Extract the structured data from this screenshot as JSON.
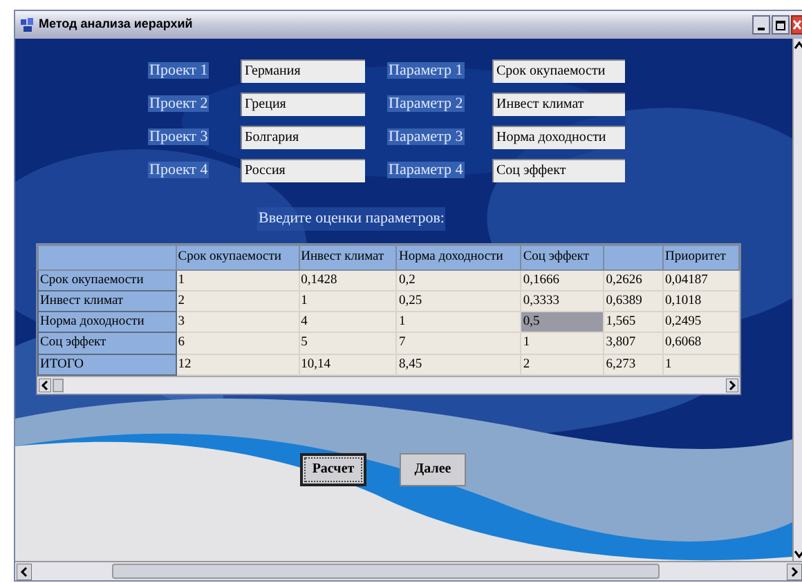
{
  "window": {
    "title": "Метод анализа иерархий"
  },
  "projects": [
    {
      "label": "Проект 1",
      "value": "Германия"
    },
    {
      "label": "Проект 2",
      "value": "Греция"
    },
    {
      "label": "Проект 3",
      "value": "Болгария"
    },
    {
      "label": "Проект 4",
      "value": "Россия"
    }
  ],
  "parameters": [
    {
      "label": "Параметр 1",
      "value": "Срок окупаемости"
    },
    {
      "label": "Параметр 2",
      "value": "Инвест климат"
    },
    {
      "label": "Параметр 3",
      "value": "Норма доходности"
    },
    {
      "label": "Параметр 4",
      "value": "Соц эффект"
    }
  ],
  "prompt": "Введите оценки параметров:",
  "table": {
    "columns": [
      "Срок окупаемости",
      "Инвест климат",
      "Норма доходности",
      "Соц эффект",
      null,
      "Приоритет"
    ],
    "rows": [
      {
        "header": "Срок окупаемости",
        "cells": [
          {
            "text": "1",
            "selected": false
          },
          {
            "text": "0,1428",
            "selected": false
          },
          {
            "text": "0,2",
            "selected": false
          },
          {
            "text": "0,1666",
            "selected": false
          },
          {
            "text": "0,2626",
            "selected": false
          },
          {
            "text": "0,04187",
            "selected": false
          }
        ]
      },
      {
        "header": "Инвест климат",
        "cells": [
          {
            "text": "2",
            "selected": false
          },
          {
            "text": "1",
            "selected": false
          },
          {
            "text": "0,25",
            "selected": false
          },
          {
            "text": "0,3333",
            "selected": false
          },
          {
            "text": "0,6389",
            "selected": false
          },
          {
            "text": "0,1018",
            "selected": false
          }
        ]
      },
      {
        "header": "Норма доходности",
        "cells": [
          {
            "text": "3",
            "selected": false
          },
          {
            "text": "4",
            "selected": false
          },
          {
            "text": "1",
            "selected": false
          },
          {
            "text": "0,5",
            "selected": true
          },
          {
            "text": "1,565",
            "selected": false
          },
          {
            "text": "0,2495",
            "selected": false
          }
        ]
      },
      {
        "header": "Соц эффект",
        "cells": [
          {
            "text": "6",
            "selected": false
          },
          {
            "text": "5",
            "selected": false
          },
          {
            "text": "7",
            "selected": false
          },
          {
            "text": "1",
            "selected": false
          },
          {
            "text": "3,807",
            "selected": false
          },
          {
            "text": "0,6068",
            "selected": false
          }
        ]
      },
      {
        "header": "ИТОГО",
        "cells": [
          {
            "text": "12",
            "selected": false
          },
          {
            "text": "10,14",
            "selected": false
          },
          {
            "text": "8,45",
            "selected": false
          },
          {
            "text": "2",
            "selected": false
          },
          {
            "text": "6,273",
            "selected": false
          },
          {
            "text": "1",
            "selected": false
          }
        ]
      }
    ]
  },
  "buttons": [
    {
      "label": "Расчет",
      "focused": true
    },
    {
      "label": "Далее",
      "focused": false
    }
  ]
}
